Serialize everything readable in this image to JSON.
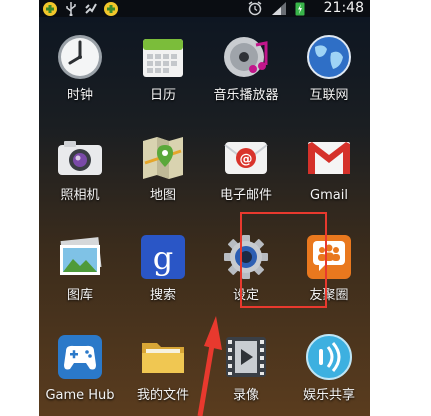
{
  "status_bar": {
    "time": "21:48",
    "icons": [
      "app-notification-icon",
      "usb-icon",
      "debug-icon",
      "app-notification-icon",
      "alarm-icon",
      "signal-icon",
      "battery-charging-icon"
    ]
  },
  "apps": [
    {
      "label": "时钟",
      "icon": "clock-icon"
    },
    {
      "label": "日历",
      "icon": "calendar-icon"
    },
    {
      "label": "音乐播放器",
      "icon": "music-player-icon"
    },
    {
      "label": "互联网",
      "icon": "internet-globe-icon"
    },
    {
      "label": "照相机",
      "icon": "camera-icon"
    },
    {
      "label": "地图",
      "icon": "map-icon"
    },
    {
      "label": "电子邮件",
      "icon": "email-icon"
    },
    {
      "label": "Gmail",
      "icon": "gmail-icon"
    },
    {
      "label": "图库",
      "icon": "gallery-icon"
    },
    {
      "label": "搜索",
      "icon": "google-search-icon"
    },
    {
      "label": "设定",
      "icon": "settings-gear-icon"
    },
    {
      "label": "友聚圈",
      "icon": "social-hub-icon"
    },
    {
      "label": "Game Hub",
      "icon": "game-hub-icon"
    },
    {
      "label": "我的文件",
      "icon": "folder-icon"
    },
    {
      "label": "录像",
      "icon": "video-icon"
    },
    {
      "label": "娱乐共享",
      "icon": "media-share-icon"
    }
  ],
  "annotation": {
    "highlight_color": "#e8392e",
    "highlighted_app": "设定"
  }
}
